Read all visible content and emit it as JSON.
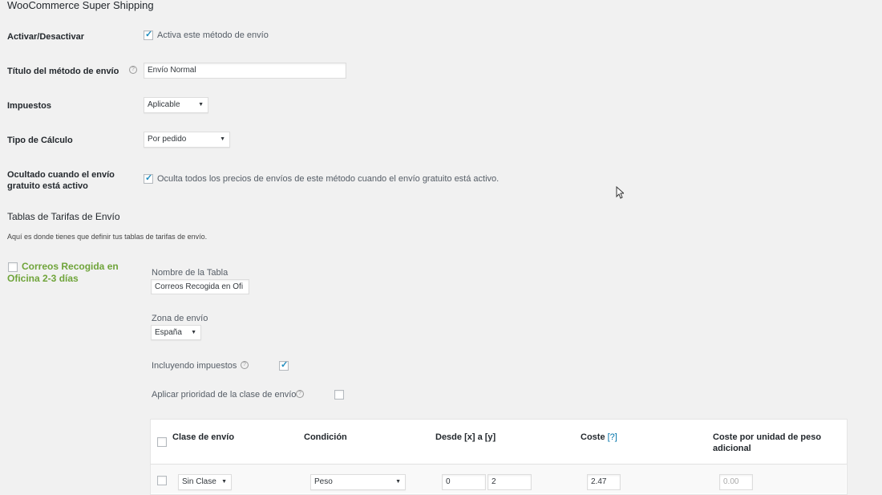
{
  "page": {
    "title": "WooCommerce Super Shipping"
  },
  "settings": {
    "enable": {
      "label": "Activar/Desactivar",
      "checkbox_text": "Activa este método de envío",
      "checked": true
    },
    "method_title": {
      "label": "Título del método de envío",
      "value": "Envío Normal"
    },
    "taxes": {
      "label": "Impuestos",
      "value": "Aplicable"
    },
    "calc_type": {
      "label": "Tipo de Cálculo",
      "value": "Por pedido"
    },
    "hide_when_free": {
      "label_line1": "Ocultado cuando el envío",
      "label_line2": "gratuito está activo",
      "checkbox_text": "Oculta todos los precios de envíos de este método cuando el envío gratuito está activo.",
      "checked": true
    }
  },
  "rates_section": {
    "title": "Tablas de Tarifas de Envío",
    "description": "Aquí es donde tienes que definir tus tablas de tarifas de envío."
  },
  "table": {
    "sidebar_title_line1": "Correos Recogida en",
    "sidebar_title_line2": "Oficina 2-3 días",
    "name_label": "Nombre de la Tabla",
    "name_value": "Correos Recogida en Ofi",
    "zone_label": "Zona de envío",
    "zone_value": "España",
    "incl_tax_label": "Incluyendo impuestos",
    "incl_tax_checked": true,
    "priority_label": "Aplicar prioridad de la clase de envío",
    "priority_checked": false,
    "columns": {
      "class": "Clase de envío",
      "condition": "Condición",
      "range": "Desde [x] a [y]",
      "cost": "Coste",
      "cost_help": "[?]",
      "extra_line1": "Coste por unidad de peso",
      "extra_line2": "adicional"
    },
    "rows": [
      {
        "class": "Sin Clase",
        "condition": "Peso",
        "from": "0",
        "to": "2",
        "cost": "2.47",
        "extra_placeholder": "0.00"
      }
    ]
  },
  "colors": {
    "accent_green": "#6fa43a",
    "link_blue": "#0073aa",
    "check_blue": "#1e8cbe"
  }
}
